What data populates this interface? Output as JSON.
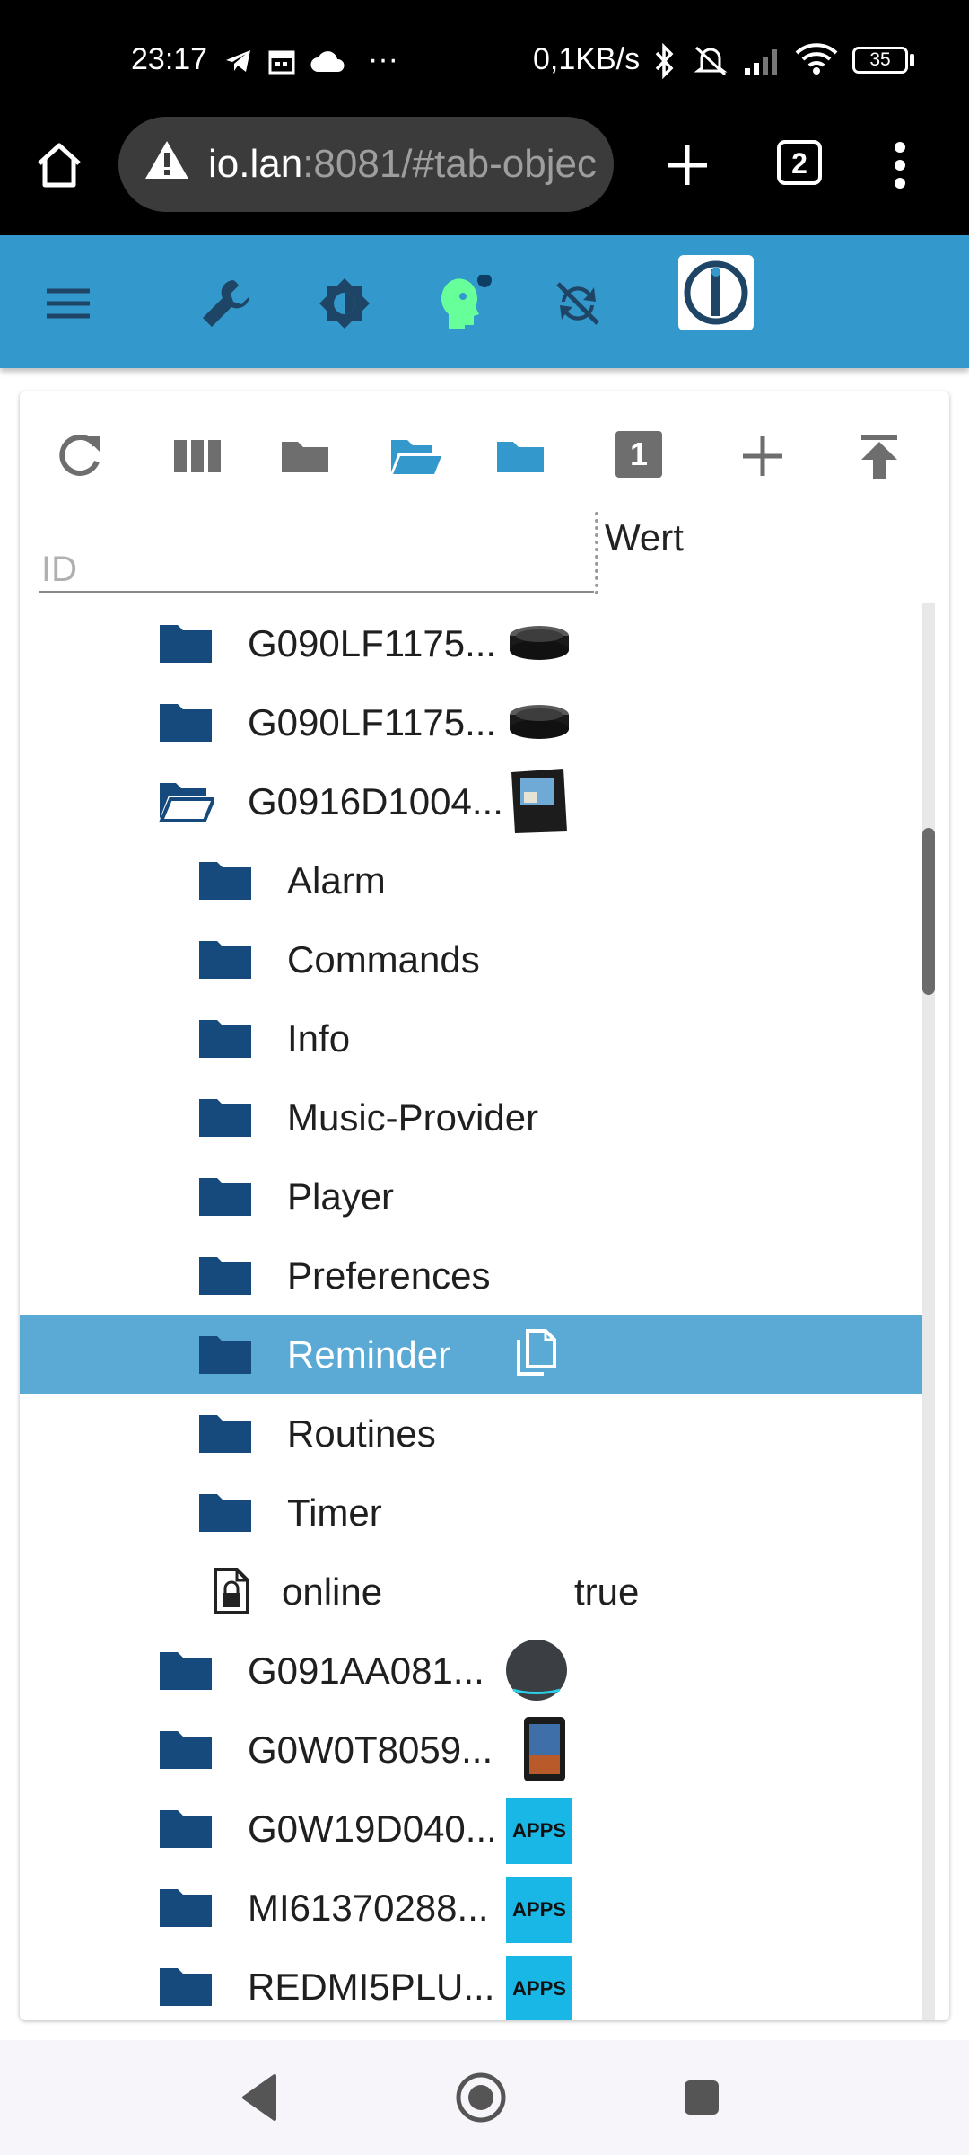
{
  "status_bar": {
    "time": "23:17",
    "network_speed": "0,1KB/s",
    "battery": "35",
    "more": "···"
  },
  "browser": {
    "url_host": "io.lan",
    "url_rest": ":8081/#tab-objec",
    "tab_count": "2"
  },
  "object_browser": {
    "filter_placeholder": "ID",
    "column_value": "Wert",
    "counter": "1",
    "rows": [
      {
        "label": "G090LF1175...",
        "device": "echo-dot"
      },
      {
        "label": "G090LF1175...",
        "device": "echo-dot"
      },
      {
        "label": "G0916D1004...",
        "device": "echo-show",
        "expanded": true
      },
      {
        "label": "Alarm"
      },
      {
        "label": "Commands"
      },
      {
        "label": "Info"
      },
      {
        "label": "Music-Provider"
      },
      {
        "label": "Player"
      },
      {
        "label": "Preferences"
      },
      {
        "label": "Reminder",
        "selected": true
      },
      {
        "label": "Routines"
      },
      {
        "label": "Timer"
      },
      {
        "label": "online",
        "value": "true"
      },
      {
        "label": "G091AA081...",
        "device": "echo-sphere"
      },
      {
        "label": "G0W0T8059...",
        "device": "fire-tablet"
      },
      {
        "label": "G0W19D040...",
        "device": "apps"
      },
      {
        "label": "MI61370288...",
        "device": "apps"
      },
      {
        "label": "REDMI5PLU...",
        "device": "apps"
      }
    ],
    "apps_badge": "APPS"
  },
  "colors": {
    "toolbar": "#3399cc",
    "folder": "#174a7c",
    "selected_row": "#5baad6",
    "toolbar_icon": "#1f4566",
    "admin_head": "#66ff99"
  }
}
